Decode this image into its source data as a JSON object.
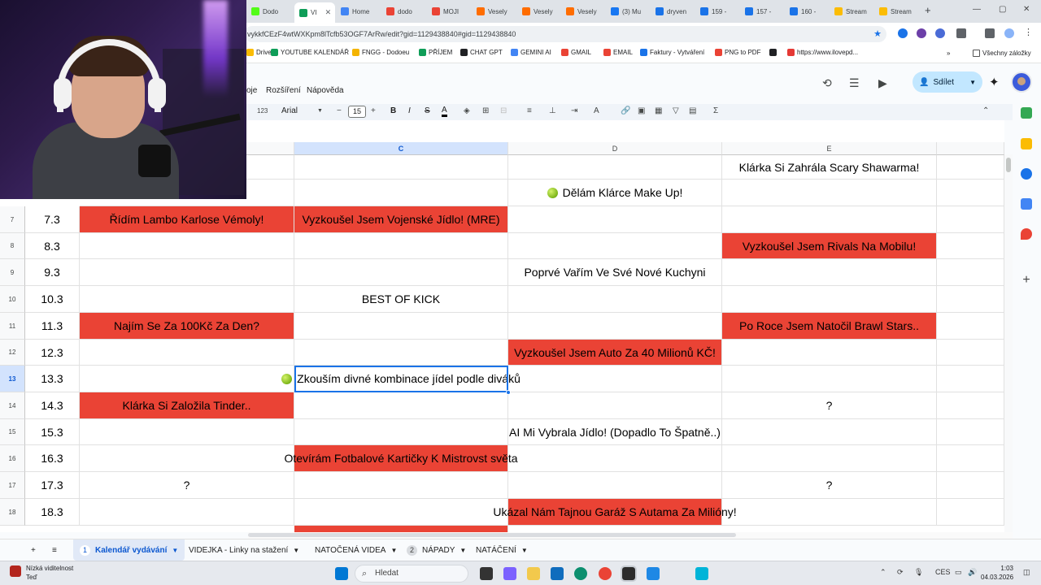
{
  "browser": {
    "tabs": [
      {
        "label": "Dodo",
        "color": "#53fc18",
        "active": false
      },
      {
        "label": "VI",
        "color": "#0f9d58",
        "active": true
      },
      {
        "label": "Home",
        "color": "#4285f4",
        "active": false
      },
      {
        "label": "dodo",
        "color": "#ea4335",
        "active": false
      },
      {
        "label": "MOJI",
        "color": "#ea4335",
        "active": false
      },
      {
        "label": "Vesely",
        "color": "#ff6d00",
        "active": false
      },
      {
        "label": "Vesely",
        "color": "#ff6d00",
        "active": false
      },
      {
        "label": "Vesely",
        "color": "#ff6d00",
        "active": false
      },
      {
        "label": "(3) Mu",
        "color": "#1877f2",
        "active": false
      },
      {
        "label": "dryven",
        "color": "#1a73e8",
        "active": false
      },
      {
        "label": "159 -",
        "color": "#1a73e8",
        "active": false
      },
      {
        "label": "157 -",
        "color": "#1a73e8",
        "active": false
      },
      {
        "label": "160 -",
        "color": "#1a73e8",
        "active": false
      },
      {
        "label": "Stream",
        "color": "#fbbc04",
        "active": false
      },
      {
        "label": "Stream",
        "color": "#fbbc04",
        "active": false
      }
    ],
    "url": "vykkfCEzF4wtWXKpm8lTcfb53OGF7ArRw/edit?gid=1129438840#gid=1129438840",
    "bookmarks": [
      {
        "label": "Drive",
        "color": "#fbbc04"
      },
      {
        "label": "YOUTUBE KALENDÁŘ",
        "color": "#0f9d58"
      },
      {
        "label": "FNGG - Dodoeu",
        "color": "#f4b400"
      },
      {
        "label": "PŘÍJEM",
        "color": "#0f9d58"
      },
      {
        "label": "CHAT GPT",
        "color": "#202124"
      },
      {
        "label": "GEMINI AI",
        "color": "#4285f4"
      },
      {
        "label": "GMAIL",
        "color": "#ea4335"
      },
      {
        "label": "EMAIL",
        "color": "#ea4335"
      },
      {
        "label": "Faktury - Vytváření",
        "color": "#1a73e8"
      },
      {
        "label": "PNG to PDF",
        "color": "#ea4335"
      },
      {
        "label": "",
        "color": "#202124"
      },
      {
        "label": "https://www.ilovepd...",
        "color": "#e53935"
      }
    ],
    "bookmarks_more": "»",
    "all_bookmarks": "Všechny záložky"
  },
  "sheets": {
    "menu": [
      "oje",
      "Rozšíření",
      "Nápověda"
    ],
    "share_label": "Sdílet",
    "toolbar": {
      "format_123": "123",
      "font_name": "Arial",
      "font_size": "15",
      "bold": "B",
      "italic": "I",
      "strike": "S",
      "text_color": "A",
      "sigma": "Σ"
    },
    "columns": [
      {
        "label": "",
        "selected": false
      },
      {
        "label": "C",
        "selected": true
      },
      {
        "label": "D",
        "selected": false
      },
      {
        "label": "E",
        "selected": false
      }
    ],
    "rows": [
      {
        "num": "",
        "date": "",
        "b": "",
        "b_red": false,
        "c": "",
        "c_red": false,
        "d": "",
        "d_red": false,
        "e": "Klárka Si Zahrála Scary Shawarma!",
        "e_red": false
      },
      {
        "num": "",
        "date": "",
        "b": "",
        "b_red": false,
        "c": "",
        "c_red": false,
        "d": "Dělám Klárce Make Up!",
        "d_red": false,
        "d_lime": true,
        "e": "",
        "e_red": false
      },
      {
        "num": "7",
        "date": "7.3",
        "b": "Řídím Lambo Karlose Vémoly!",
        "b_red": true,
        "c": "Vyzkoušel Jsem Vojenské Jídlo! (MRE)",
        "c_red": true,
        "d": "",
        "d_red": false,
        "e": "",
        "e_red": false
      },
      {
        "num": "8",
        "date": "8.3",
        "b": "",
        "b_red": false,
        "c": "",
        "c_red": false,
        "d": "",
        "d_red": false,
        "e": "Vyzkoušel Jsem Rivals Na Mobilu!",
        "e_red": true
      },
      {
        "num": "9",
        "date": "9.3",
        "b": "",
        "b_red": false,
        "c": "",
        "c_red": false,
        "d": "Poprvé Vařím Ve Své Nové Kuchyni",
        "d_red": false,
        "e": "",
        "e_red": false
      },
      {
        "num": "10",
        "date": "10.3",
        "b": "",
        "b_red": false,
        "c": "BEST OF KICK",
        "c_red": false,
        "d": "",
        "d_red": false,
        "e": "",
        "e_red": false
      },
      {
        "num": "11",
        "date": "11.3",
        "b": "Najím Se Za 100Kč Za Den?",
        "b_red": true,
        "c": "",
        "c_red": false,
        "d": "",
        "d_red": false,
        "e": "Po Roce Jsem Natočil Brawl Stars..",
        "e_red": true
      },
      {
        "num": "12",
        "date": "12.3",
        "b": "",
        "b_red": false,
        "c": "",
        "c_red": false,
        "d": "Vyzkoušel Jsem Auto Za 40 Milionů KČ!",
        "d_red": true,
        "e": "",
        "e_red": false
      },
      {
        "num": "13",
        "date": "13.3",
        "b": "",
        "b_red": false,
        "c": "Zkouším divné kombinace jídel podle diváků",
        "c_red": false,
        "c_lime": true,
        "c_selected": true,
        "d": "",
        "d_red": false,
        "e": "",
        "e_red": false
      },
      {
        "num": "14",
        "date": "14.3",
        "b": "Klárka Si Založila Tinder..",
        "b_red": true,
        "c": "",
        "c_red": false,
        "d": "",
        "d_red": false,
        "e": "?",
        "e_red": false
      },
      {
        "num": "15",
        "date": "15.3",
        "b": "",
        "b_red": false,
        "c": "",
        "c_red": false,
        "d": "AI Mi Vybrala Jídlo! (Dopadlo To Špatně..)",
        "d_red": false,
        "e": "",
        "e_red": false
      },
      {
        "num": "16",
        "date": "16.3",
        "b": "",
        "b_red": false,
        "c": "Otevírám Fotbalové Kartičky K Mistrovst světa",
        "c_red": true,
        "d": "",
        "d_red": false,
        "e": "",
        "e_red": false
      },
      {
        "num": "17",
        "date": "17.3",
        "b": "?",
        "b_red": false,
        "c": "",
        "c_red": false,
        "d": "",
        "d_red": false,
        "e": "?",
        "e_red": false
      },
      {
        "num": "18",
        "date": "18.3",
        "b": "",
        "b_red": false,
        "c": "",
        "c_red": false,
        "d": "Ukázal Nám Tajnou Garáž S Autama Za Milióny!",
        "d_red": true,
        "e": "",
        "e_red": false
      }
    ],
    "sheet_tabs": [
      {
        "num": "1",
        "label": "Kalendář vydávání",
        "active": true
      },
      {
        "num": "",
        "label": "VIDEJKA - Linky na stažení",
        "active": false
      },
      {
        "num": "",
        "label": "NATOČENÁ VIDEA",
        "active": false
      },
      {
        "num": "2",
        "label": "NÁPADY",
        "active": false
      },
      {
        "num": "",
        "label": "NATÁČENÍ",
        "active": false
      }
    ],
    "red_color": "#ea4335",
    "selection_color": "#1a73e8"
  },
  "taskbar": {
    "visibility_title": "Nízká viditelnost",
    "visibility_sub": "Teď",
    "search_placeholder": "Hledat",
    "lang": "CES",
    "time": "1:03",
    "date": "04.03.2026"
  }
}
